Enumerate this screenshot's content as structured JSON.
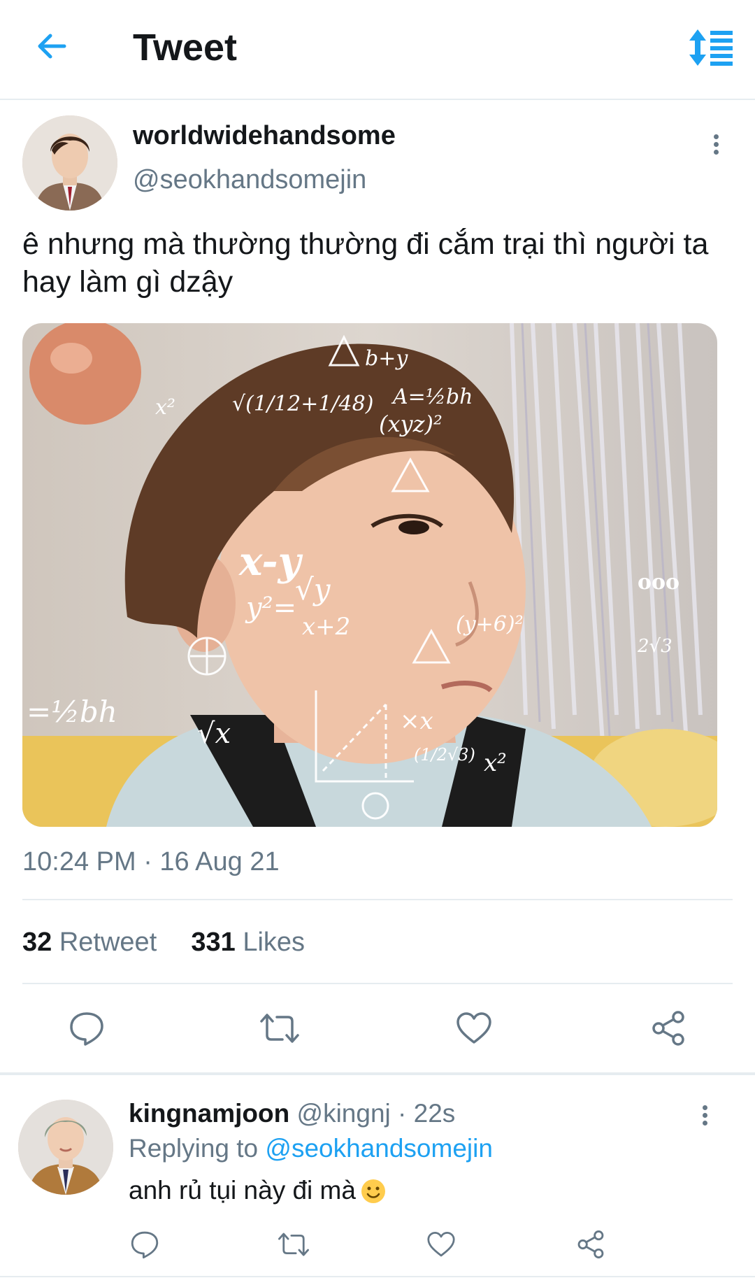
{
  "header": {
    "title": "Tweet",
    "back_icon": "arrow-left-icon",
    "sort_icon": "sort-list-icon",
    "accent": "#1da1f2"
  },
  "tweet": {
    "display_name": "worldwidehandsome",
    "handle": "@seokhandsomejin",
    "text": "ê nhưng mà thường thường đi cắm trại thì người ta hay làm gì dzậy",
    "timestamp": "10:24 PM · 16 Aug 21",
    "retweet_count": "32",
    "retweet_label": "Retweet",
    "like_count": "331",
    "like_label": "Likes",
    "media_overlay_equations": [
      "x-y",
      "y²=",
      "x+2",
      "A=½bh",
      "(xyz)²",
      "(y+6)²",
      "√(1/12+1/48)",
      "½bh",
      "b+y",
      "x²",
      "ooo"
    ]
  },
  "reply": {
    "display_name": "kingnamjoon",
    "handle": "@kingnj",
    "time": "· 22s",
    "replying_label": "Replying to",
    "replying_to": "@seokhandsomejin",
    "text": "anh rủ tụi này đi mà"
  },
  "colors": {
    "text": "#14171a",
    "secondary": "#657786",
    "link": "#1da1f2",
    "divider": "#e6ecf0"
  }
}
